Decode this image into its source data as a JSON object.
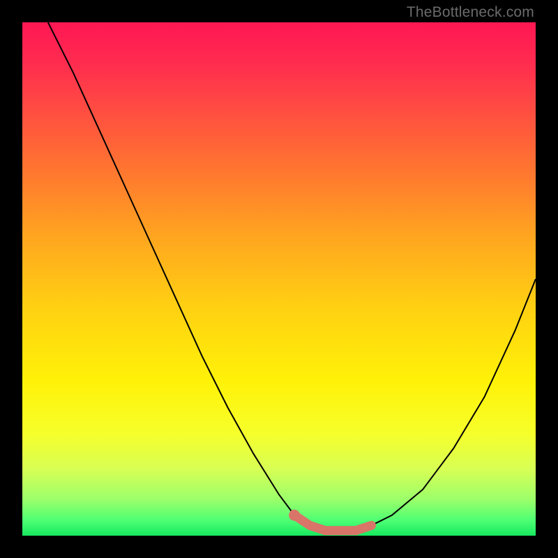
{
  "watermark": "TheBottleneck.com",
  "chart_data": {
    "type": "line",
    "title": "",
    "xlabel": "",
    "ylabel": "",
    "xlim": [
      0,
      100
    ],
    "ylim": [
      0,
      100
    ],
    "series": [
      {
        "name": "curve",
        "x": [
          5,
          10,
          15,
          20,
          25,
          30,
          35,
          40,
          45,
          50,
          53,
          56,
          59,
          62,
          65,
          68,
          72,
          78,
          84,
          90,
          96,
          100
        ],
        "values": [
          100,
          90,
          79,
          68,
          57,
          46,
          35,
          25,
          16,
          8,
          4,
          2,
          1,
          1,
          1,
          2,
          4,
          9,
          17,
          27,
          40,
          50
        ]
      }
    ],
    "highlight_region": {
      "x_start": 53,
      "x_end": 68
    },
    "marker": {
      "x": 53,
      "y": 4
    },
    "background_gradient": {
      "top": "#ff1753",
      "mid": "#ffe800",
      "bottom": "#17e85f"
    }
  }
}
